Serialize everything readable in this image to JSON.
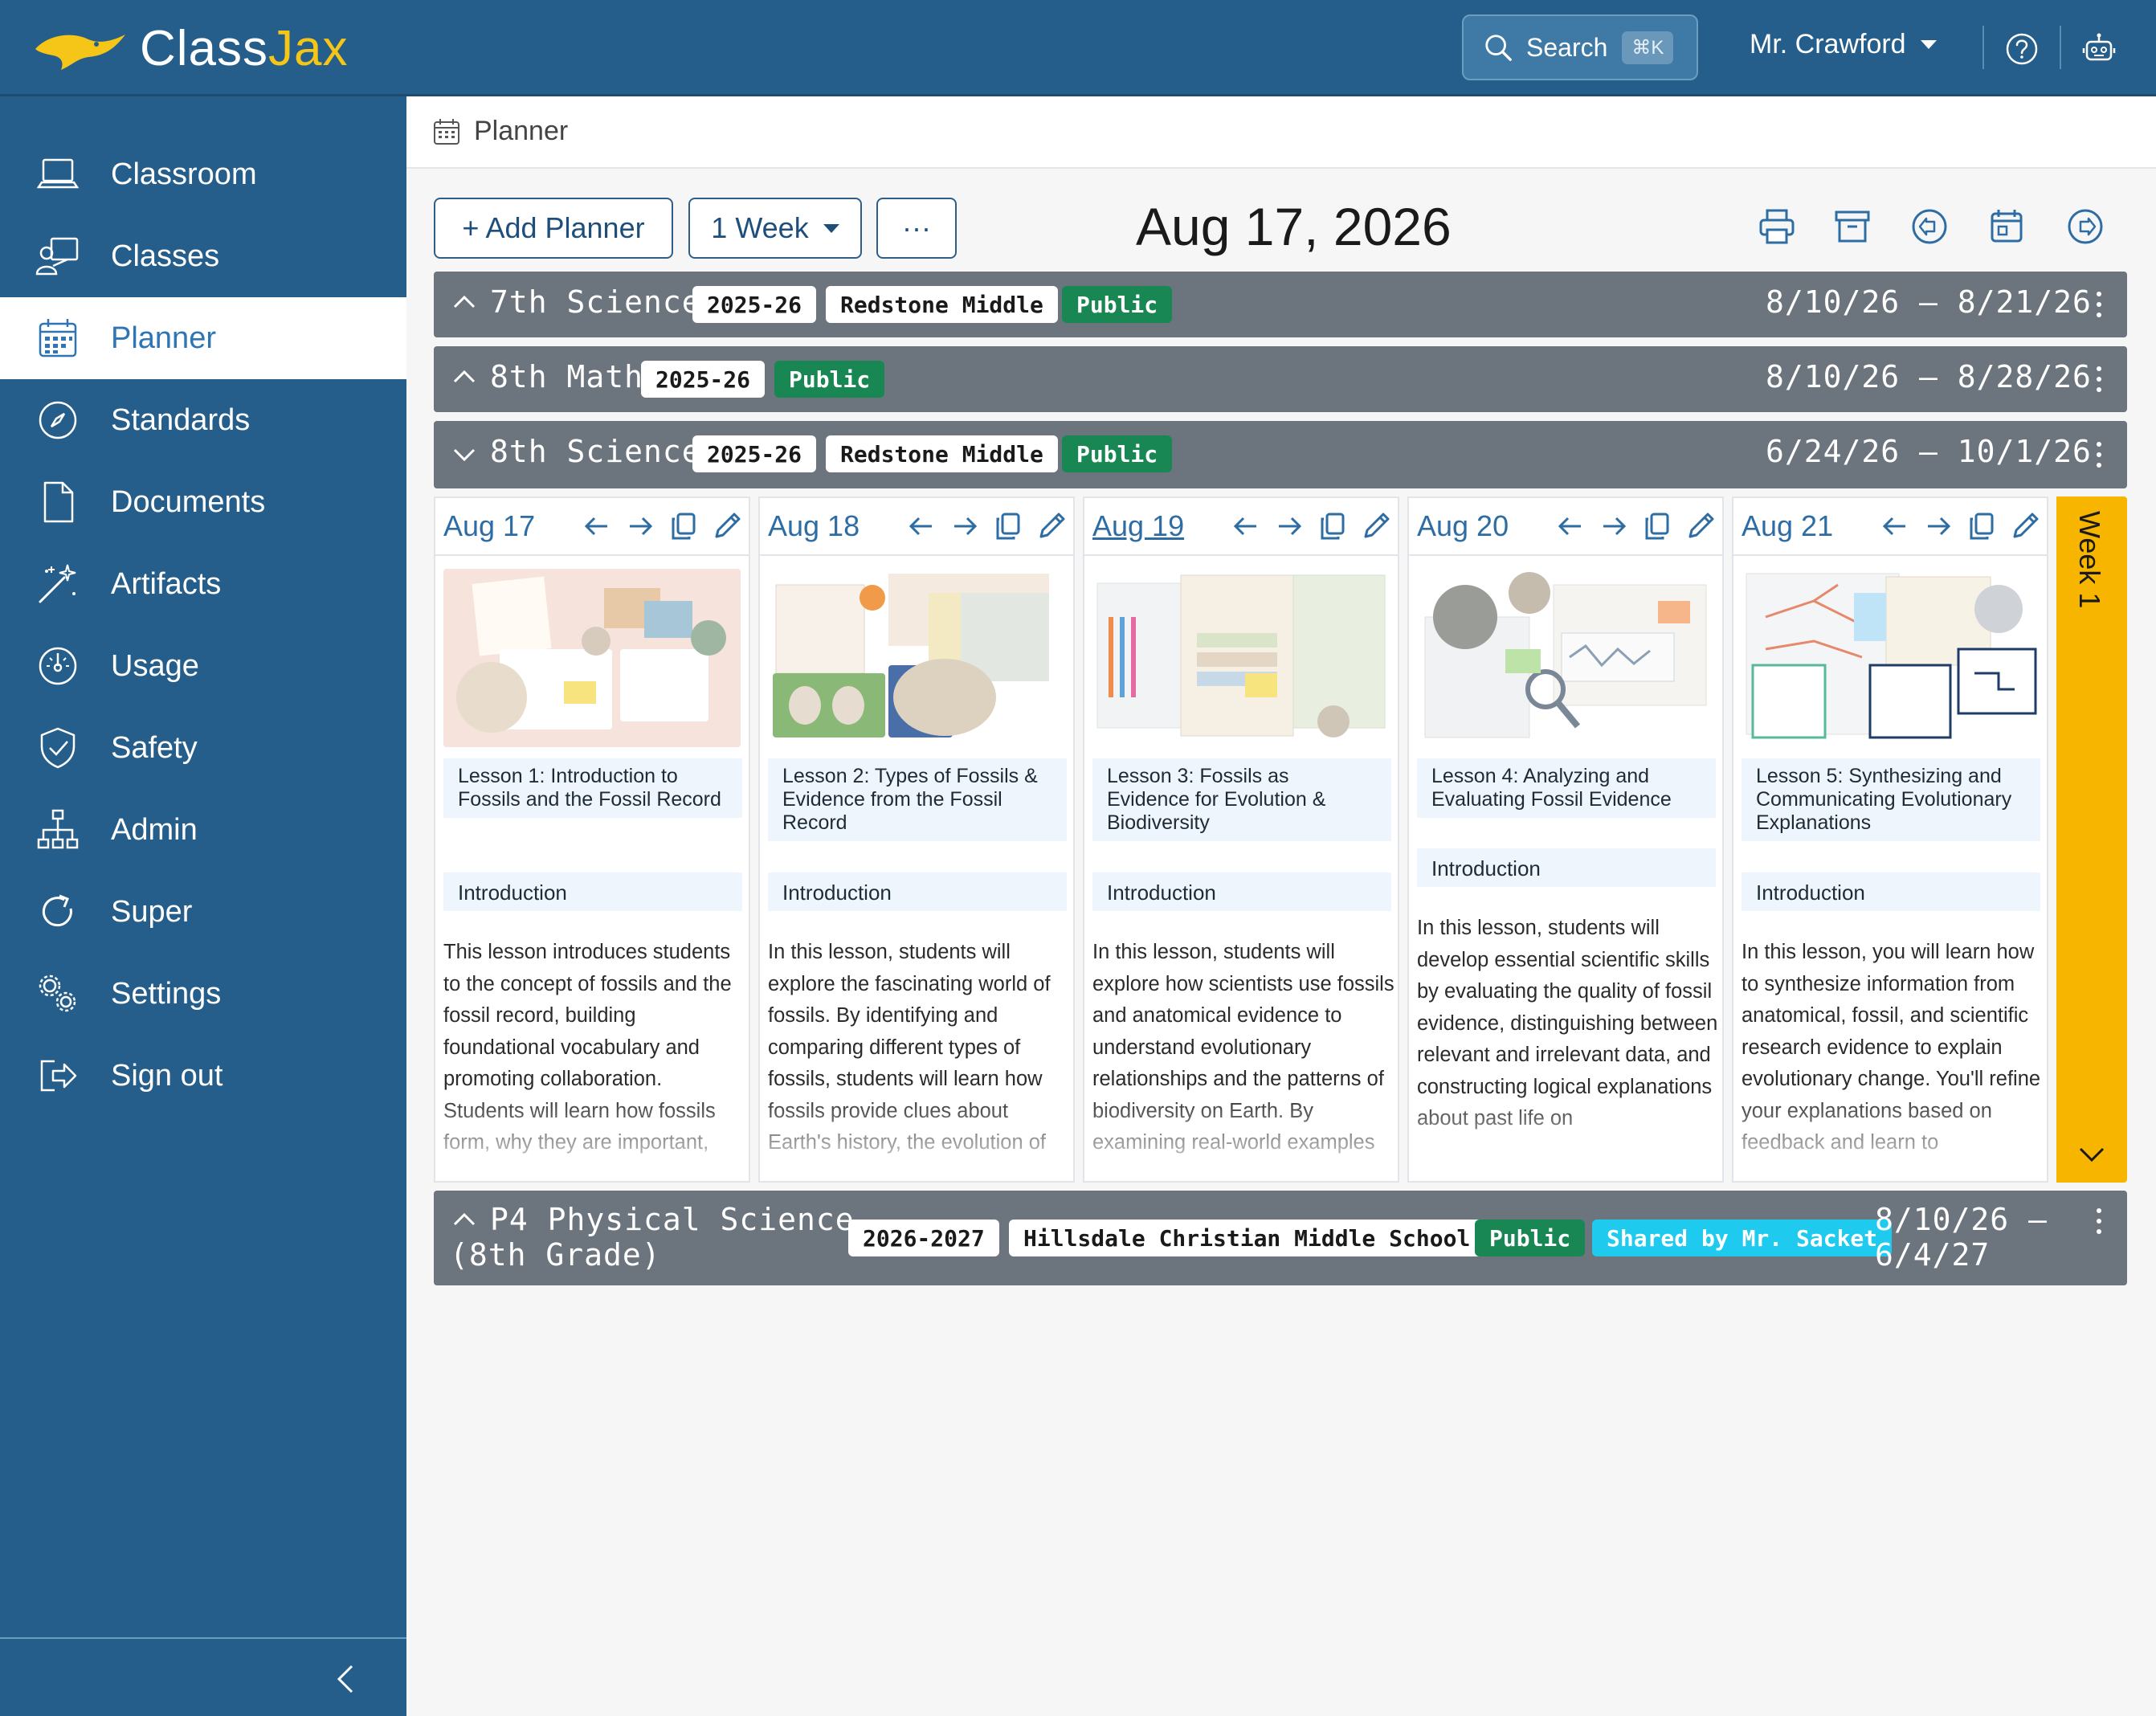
{
  "app": {
    "logo_a": "Class",
    "logo_b": "Jax"
  },
  "search": {
    "label": "Search",
    "shortcut": "⌘K"
  },
  "user": {
    "name": "Mr. Crawford"
  },
  "sidebar": {
    "items": [
      {
        "label": "Classroom",
        "icon": "laptop-icon"
      },
      {
        "label": "Classes",
        "icon": "teacher-icon"
      },
      {
        "label": "Planner",
        "icon": "calendar-icon",
        "active": true
      },
      {
        "label": "Standards",
        "icon": "compass-icon"
      },
      {
        "label": "Documents",
        "icon": "file-icon"
      },
      {
        "label": "Artifacts",
        "icon": "magic-wand-icon"
      },
      {
        "label": "Usage",
        "icon": "speedometer-icon"
      },
      {
        "label": "Safety",
        "icon": "shield-check-icon"
      },
      {
        "label": "Admin",
        "icon": "org-chart-icon"
      },
      {
        "label": "Super",
        "icon": "refresh-icon"
      },
      {
        "label": "Settings",
        "icon": "gears-icon"
      },
      {
        "label": "Sign out",
        "icon": "sign-out-icon"
      }
    ]
  },
  "page": {
    "title": "Planner"
  },
  "toolbar": {
    "add_planner": "+ Add Planner",
    "range": "1 Week",
    "more": "···",
    "date": "Aug 17, 2026"
  },
  "planners": [
    {
      "title": "7th Science",
      "year": "2025-26",
      "school": "Redstone Middle",
      "visibility": "Public",
      "range": "8/10/26 – 8/21/26"
    },
    {
      "title": "8th Math",
      "year": "2025-26",
      "visibility": "Public",
      "range": "8/10/26 – 8/28/26"
    },
    {
      "title": "8th Science",
      "year": "2025-26",
      "school": "Redstone Middle",
      "visibility": "Public",
      "range": "6/24/26 – 10/1/26"
    },
    {
      "title_line1": "P4 Physical Science",
      "title_line2": "(8th Grade)",
      "year": "2026-2027",
      "school": "Hillsdale Christian Middle School",
      "visibility": "Public",
      "shared": "Shared by Mr. Sacket",
      "range_line1": "8/10/26 –",
      "range_line2": "6/4/27"
    }
  ],
  "days": [
    {
      "date": "Aug 17",
      "lesson": "Lesson 1: Introduction to Fossils and the Fossil Record",
      "section": "Introduction",
      "description": "This lesson introduces students to the concept of fossils and the fossil record, building foundational vocabulary and promoting collaboration. Students will learn how fossils form, why they are important,"
    },
    {
      "date": "Aug 18",
      "lesson": "Lesson 2: Types of Fossils & Evidence from the Fossil Record",
      "section": "Introduction",
      "description": "In this lesson, students will explore the fascinating world of fossils. By identifying and comparing different types of fossils, students will learn how fossils provide clues about Earth's history, the evolution of"
    },
    {
      "date": "Aug 19",
      "lesson": "Lesson 3: Fossils as Evidence for Evolution & Biodiversity",
      "section": "Introduction",
      "description": "In this lesson, students will explore how scientists use fossils and anatomical evidence to understand evolutionary relationships and the patterns of biodiversity on Earth. By examining real-world examples"
    },
    {
      "date": "Aug 20",
      "lesson": "Lesson 4: Analyzing and Evaluating Fossil Evidence",
      "section": "Introduction",
      "description": "In this lesson, students will develop essential scientific skills by evaluating the quality of fossil evidence, distinguishing between relevant and irrelevant data, and constructing logical explanations about past life on"
    },
    {
      "date": "Aug 21",
      "lesson": "Lesson 5: Synthesizing and Communicating Evolutionary Explanations",
      "section": "Introduction",
      "description": "In this lesson, you will learn how to synthesize information from anatomical, fossil, and scientific research evidence to explain evolutionary change. You'll refine your explanations based on feedback and learn to"
    }
  ],
  "week": {
    "label": "Week 1"
  },
  "colors": {
    "brand": "#255e8a",
    "accent": "#f5c518",
    "bar": "#6c747d",
    "public": "#198754",
    "shared": "#1ecbee",
    "week": "#f8b500"
  }
}
